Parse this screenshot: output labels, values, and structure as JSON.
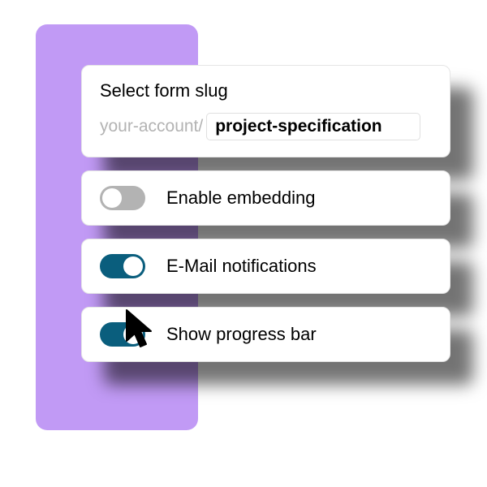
{
  "slug": {
    "title": "Select form slug",
    "prefix": "your-account/",
    "value": "project-specification"
  },
  "toggles": {
    "embedding": {
      "label": "Enable embedding",
      "on": false
    },
    "email": {
      "label": "E-Mail notifications",
      "on": true
    },
    "progress": {
      "label": "Show progress bar",
      "on": true
    }
  },
  "colors": {
    "accent_purple": "#c19af5",
    "toggle_on": "#0a5e7d",
    "toggle_off": "#b3b3b3"
  }
}
